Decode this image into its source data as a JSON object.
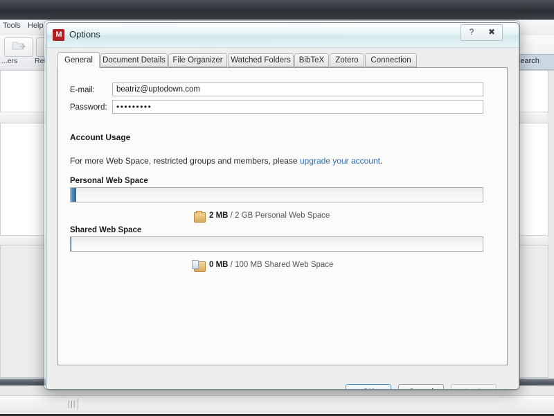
{
  "background": {
    "menus": [
      "Tools",
      "Help"
    ],
    "toolbar_buttons": [
      {
        "label": "...ers",
        "icon": "folder-arrow-icon"
      },
      {
        "label": "Rel...",
        "icon": "related-icon"
      }
    ],
    "search_label": "Search"
  },
  "dialog": {
    "title": "Options",
    "app_icon": "mendeley-logo-icon",
    "help_button": "?",
    "close_button": "✖",
    "tabs": [
      {
        "label": "General",
        "active": true
      },
      {
        "label": "Document Details",
        "active": false
      },
      {
        "label": "File Organizer",
        "active": false
      },
      {
        "label": "Watched Folders",
        "active": false
      },
      {
        "label": "BibTeX",
        "active": false
      },
      {
        "label": "Zotero",
        "active": false
      },
      {
        "label": "Connection",
        "active": false
      }
    ],
    "general": {
      "email_label": "E-mail:",
      "email_value": "beatriz@uptodown.com",
      "email_placeholder": "",
      "password_label": "Password:",
      "password_value": "•••••••••",
      "password_placeholder": "",
      "account_usage_title": "Account Usage",
      "account_usage_desc_pre": "For more Web Space, restricted groups and members, please ",
      "account_usage_link": "upgrade your account",
      "account_usage_desc_post": ".",
      "personal": {
        "label": "Personal Web Space",
        "used": "2 MB",
        "separator": " / ",
        "quota_text": "2 GB Personal Web Space",
        "percent": 1,
        "icon": "folder-icon"
      },
      "shared": {
        "label": "Shared Web Space",
        "used": "0 MB",
        "separator": " / ",
        "quota_text": "100 MB Shared Web Space",
        "percent": 0,
        "icon": "shared-folder-icon"
      }
    },
    "footer": {
      "ok_label": "OK",
      "cancel_label": "Cancel",
      "apply_label": "Apply"
    }
  },
  "colors": {
    "accent_blue": "#3f74a6",
    "link_blue": "#2f6fb0",
    "logo_red": "#b01d23",
    "default_button_border": "#3c95cd"
  }
}
